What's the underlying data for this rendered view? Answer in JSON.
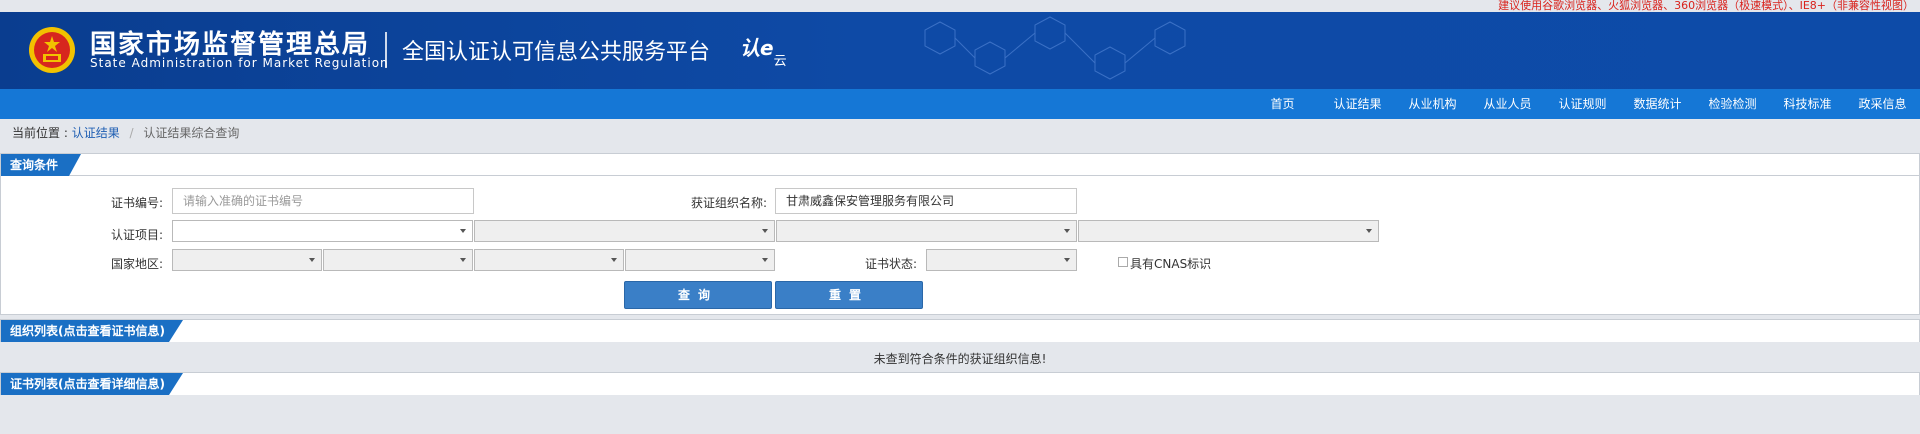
{
  "notice": "建议使用谷歌浏览器、火狐浏览器、360浏览器（极速模式）、IE8+（非兼容性视图）",
  "header": {
    "title_cn": "国家市场监督管理总局",
    "title_en": "State Administration  for  Market Regulation",
    "platform": "全国认证认可信息公共服务平台",
    "logo_main": "认e",
    "logo_sub": "云"
  },
  "nav": {
    "items": [
      {
        "label": "首页"
      },
      {
        "label": "认证结果"
      },
      {
        "label": "从业机构"
      },
      {
        "label": "从业人员"
      },
      {
        "label": "认证规则"
      },
      {
        "label": "数据统计"
      },
      {
        "label": "检验检测"
      },
      {
        "label": "科技标准"
      },
      {
        "label": "政采信息"
      }
    ]
  },
  "breadcrumb": {
    "prefix": "当前位置 :",
    "link": "认证结果",
    "separator": "/",
    "current": "认证结果综合查询"
  },
  "query": {
    "title": "查询条件",
    "cert_no_label": "证书编号:",
    "cert_no_placeholder": "请输入准确的证书编号",
    "org_name_label": "获证组织名称:",
    "org_name_value": "甘肃威鑫保安管理服务有限公司",
    "project_label": "认证项目:",
    "region_label": "国家地区:",
    "status_label": "证书状态:",
    "cnas_label": "具有CNAS标识",
    "search_button": "查询",
    "reset_button": "重置"
  },
  "org_list": {
    "title": "组织列表(点击查看证书信息)",
    "empty_message": "未查到符合条件的获证组织信息!"
  },
  "cert_list": {
    "title": "证书列表(点击查看详细信息)"
  },
  "colors": {
    "header_blue": "#0e4aa6",
    "nav_blue": "#1577d6",
    "tab_blue": "#1a6fc4",
    "button_blue": "#3a7fc7",
    "notice_red": "#d9221c"
  }
}
